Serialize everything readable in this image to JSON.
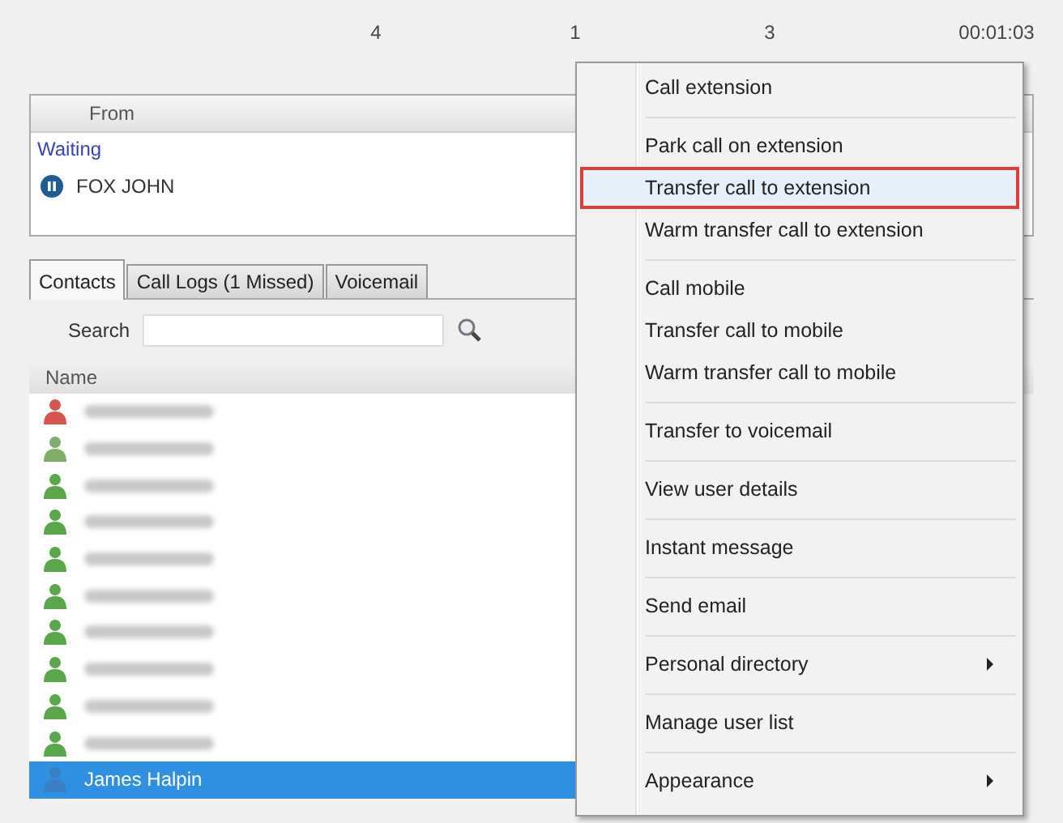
{
  "header_values": [
    "4",
    "1",
    "3",
    "00:01:03"
  ],
  "calls": {
    "column": "From",
    "group": "Waiting",
    "rows": [
      {
        "caller": "FOX JOHN",
        "on_hold": true
      }
    ]
  },
  "tabs": [
    {
      "label": "Contacts",
      "selected": true
    },
    {
      "label": "Call Logs (1 Missed)",
      "selected": false
    },
    {
      "label": "Voicemail",
      "selected": false
    }
  ],
  "search": {
    "label": "Search"
  },
  "contacts": {
    "column": "Name",
    "rows": [
      {
        "color": "#d9534f",
        "selected": false
      },
      {
        "color": "#7fae6a",
        "selected": false
      },
      {
        "color": "#5aa64a",
        "selected": false
      },
      {
        "color": "#5aa64a",
        "selected": false
      },
      {
        "color": "#5aa64a",
        "selected": false
      },
      {
        "color": "#5aa64a",
        "selected": false
      },
      {
        "color": "#5aa64a",
        "selected": false
      },
      {
        "color": "#5aa64a",
        "selected": false
      },
      {
        "color": "#5aa64a",
        "selected": false
      },
      {
        "color": "#5aa64a",
        "selected": false
      },
      {
        "color": "#3a7fc4",
        "selected": true,
        "name": "James Halpin"
      }
    ]
  },
  "context_menu": {
    "groups": [
      [
        {
          "label": "Call extension",
          "selected": false,
          "submenu": false
        }
      ],
      [
        {
          "label": "Park call on extension",
          "selected": false,
          "submenu": false
        },
        {
          "label": "Transfer call to extension",
          "selected": true,
          "submenu": false
        },
        {
          "label": "Warm transfer call to extension",
          "selected": false,
          "submenu": false
        }
      ],
      [
        {
          "label": "Call mobile",
          "selected": false,
          "submenu": false
        },
        {
          "label": "Transfer call to mobile",
          "selected": false,
          "submenu": false
        },
        {
          "label": "Warm transfer call to mobile",
          "selected": false,
          "submenu": false
        }
      ],
      [
        {
          "label": "Transfer to voicemail",
          "selected": false,
          "submenu": false
        }
      ],
      [
        {
          "label": "View user details",
          "selected": false,
          "submenu": false
        }
      ],
      [
        {
          "label": "Instant message",
          "selected": false,
          "submenu": false
        }
      ],
      [
        {
          "label": "Send email",
          "selected": false,
          "submenu": false
        }
      ],
      [
        {
          "label": "Personal directory",
          "selected": false,
          "submenu": true
        }
      ],
      [
        {
          "label": "Manage user list",
          "selected": false,
          "submenu": false
        }
      ],
      [
        {
          "label": "Appearance",
          "selected": false,
          "submenu": true
        }
      ]
    ]
  }
}
